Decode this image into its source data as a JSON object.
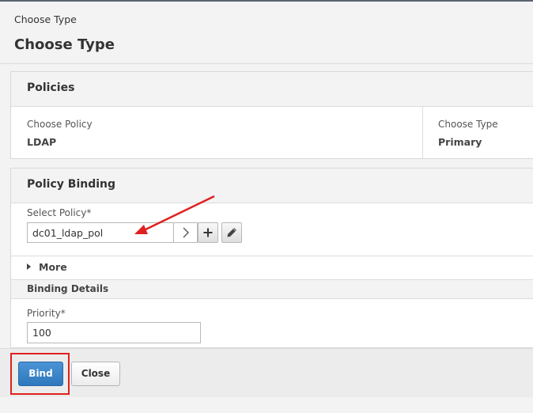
{
  "breadcrumb": "Choose Type",
  "page_title": "Choose Type",
  "policies": {
    "title": "Policies",
    "choose_policy_label": "Choose Policy",
    "choose_policy_value": "LDAP",
    "choose_type_label": "Choose Type",
    "choose_type_value": "Primary"
  },
  "policy_binding": {
    "title": "Policy Binding",
    "select_policy_label": "Select Policy*",
    "select_policy_value": "dc01_ldap_pol",
    "more_label": "More",
    "binding_details_label": "Binding Details",
    "priority_label": "Priority*",
    "priority_value": "100"
  },
  "buttons": {
    "bind": "Bind",
    "close": "Close"
  },
  "colors": {
    "primary_button": "#3a86cc",
    "annotation_red": "#e02020"
  },
  "icons": {
    "select_arrow": "chevron-right-icon",
    "add": "plus-icon",
    "edit": "pencil-icon",
    "more_toggle": "triangle-right-icon"
  }
}
